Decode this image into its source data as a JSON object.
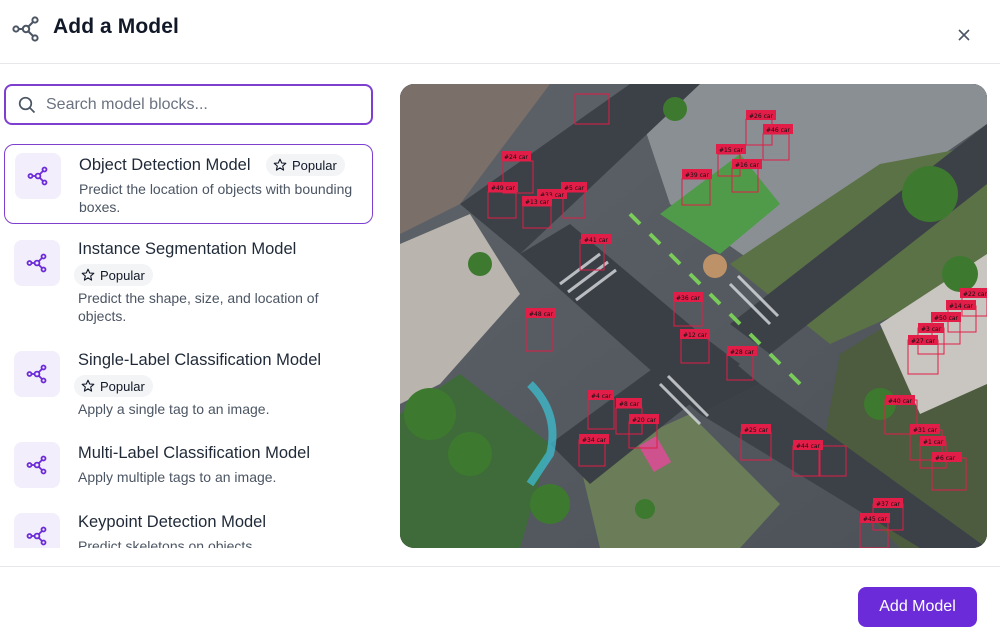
{
  "dialog": {
    "title": "Add a Model",
    "header_icon": "model-graph-icon",
    "close_icon": "close-icon"
  },
  "search": {
    "placeholder": "Search model blocks...",
    "value": ""
  },
  "models": [
    {
      "title": "Object Detection Model",
      "badge": "Popular",
      "description": "Predict the location of objects with bounding boxes.",
      "selected": true
    },
    {
      "title": "Instance Segmentation Model",
      "badge": "Popular",
      "description": "Predict the shape, size, and location of objects.",
      "selected": false
    },
    {
      "title": "Single-Label Classification Model",
      "badge": "Popular",
      "description": "Apply a single tag to an image.",
      "selected": false
    },
    {
      "title": "Multi-Label Classification Model",
      "badge": "",
      "description": "Apply multiple tags to an image.",
      "selected": false
    },
    {
      "title": "Keypoint Detection Model",
      "badge": "",
      "description": "Predict skeletons on objects.",
      "selected": false
    }
  ],
  "preview": {
    "detections": [
      "#24 car",
      "#49 car",
      "#33 car",
      "#5 car",
      "#13 car",
      "#41 car",
      "#39 car",
      "#15 car",
      "#16 car",
      "#26 car",
      "#46 car",
      "#36 car",
      "#12 car",
      "#28 car",
      "#48 car",
      "#4 car",
      "#8 car",
      "#20 car",
      "#34 car",
      "#25 car",
      "#44 car",
      "#22 car",
      "#14 car",
      "#50 car",
      "#3 car",
      "#27 car",
      "#40 car",
      "#31 car",
      "#1 car",
      "#6 car",
      "#37 car",
      "#45 car"
    ]
  },
  "footer": {
    "add_button": "Add Model"
  },
  "colors": {
    "accent": "#6c2bd9",
    "selected_border": "#7e3fd1",
    "icon_bg": "#f2eefb",
    "detection_box": "#e11d48"
  }
}
